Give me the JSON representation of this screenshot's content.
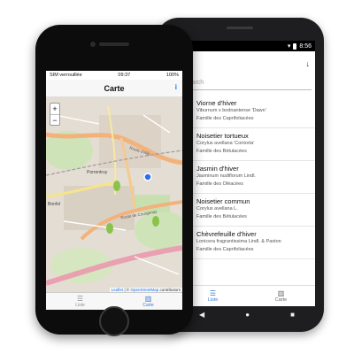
{
  "android": {
    "status": {
      "time": "8:56"
    },
    "search": {
      "placeholder": "Search"
    },
    "sort_icon": "sort-arrow-icon",
    "items": [
      {
        "name": "Viorne d'hiver",
        "latin": "Viburnum x bodnantense 'Dawn'",
        "family": "Famille des Caprifoliacées",
        "thumb_color": "#8a5a6a"
      },
      {
        "name": "Noisetier tortueux",
        "latin": "Corylus avellana 'Contorta'",
        "family": "Famille des Bétulacées",
        "thumb_color": "#6b5a3a"
      },
      {
        "name": "Jasmin d'hiver",
        "latin": "Jasminum nudiflorum Lindl.",
        "family": "Famille des Oléacées",
        "thumb_color": "#c9b235"
      },
      {
        "name": "Noisetier commun",
        "latin": "Corylus avellana L.",
        "family": "Famille des Bétulacées",
        "thumb_color": "#5e6a3a"
      },
      {
        "name": "Chèvrefeuille d'hiver",
        "latin": "Lonicera fragrantissima Lindl. & Paxton",
        "family": "Famille des Caprifoliacées",
        "thumb_color": "#4f6b35"
      }
    ],
    "tabs": [
      {
        "label": "Liste",
        "icon": "list-icon",
        "active": true
      },
      {
        "label": "Carte",
        "icon": "map-icon",
        "active": false
      }
    ],
    "nav": {
      "back": "◀",
      "home": "●",
      "recent": "■"
    }
  },
  "iphone": {
    "status": {
      "carrier": "SIM verrouillée",
      "time": "09:37",
      "battery": "100%"
    },
    "title": "Carte",
    "info": "i",
    "zoom": {
      "in": "+",
      "out": "−"
    },
    "map": {
      "labels": [
        "Porrentruy",
        "Bonfol",
        "Route de Courgenay",
        "Route d'Alle"
      ],
      "attribution_leaflet": "Leaflet",
      "attribution_osm": "OpenStreetMap",
      "attribution_suffix": "contributors"
    },
    "tabs": [
      {
        "label": "Liste",
        "icon": "list-icon",
        "active": false
      },
      {
        "label": "Carte",
        "icon": "map-icon",
        "active": true
      }
    ]
  }
}
